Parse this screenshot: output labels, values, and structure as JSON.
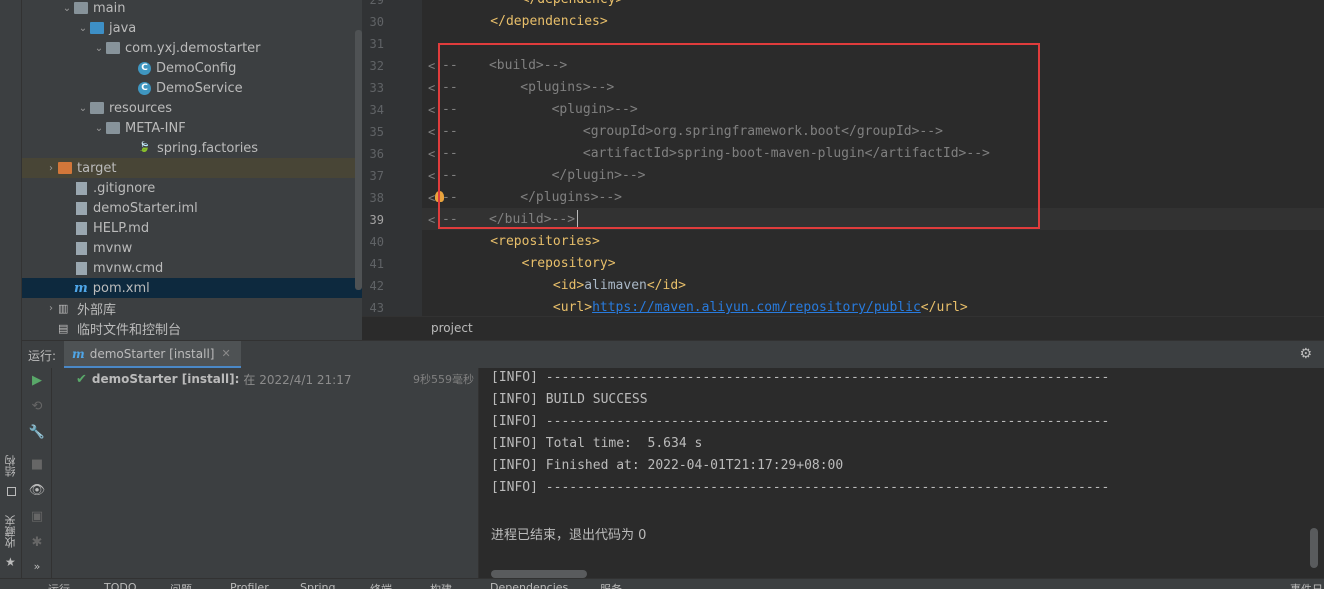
{
  "project_tree": [
    {
      "label": "main",
      "depth": 2,
      "arrow": "⌄",
      "icon": "folder-grey"
    },
    {
      "label": "java",
      "depth": 3,
      "arrow": "⌄",
      "icon": "folder-blue"
    },
    {
      "label": "com.yxj.demostarter",
      "depth": 4,
      "arrow": "⌄",
      "icon": "folder-grey"
    },
    {
      "label": "DemoConfig",
      "depth": 6,
      "arrow": "",
      "icon": "class"
    },
    {
      "label": "DemoService",
      "depth": 6,
      "arrow": "",
      "icon": "class"
    },
    {
      "label": "resources",
      "depth": 3,
      "arrow": "⌄",
      "icon": "folder-grey"
    },
    {
      "label": "META-INF",
      "depth": 4,
      "arrow": "⌄",
      "icon": "folder-grey"
    },
    {
      "label": "spring.factories",
      "depth": 6,
      "arrow": "",
      "icon": "spring-leaf"
    },
    {
      "label": "target",
      "depth": 1,
      "arrow": "›",
      "icon": "folder-orange",
      "state": "excluded"
    },
    {
      "label": ".gitignore",
      "depth": 2,
      "arrow": "",
      "icon": "file"
    },
    {
      "label": "demoStarter.iml",
      "depth": 2,
      "arrow": "",
      "icon": "file"
    },
    {
      "label": "HELP.md",
      "depth": 2,
      "arrow": "",
      "icon": "file"
    },
    {
      "label": "mvnw",
      "depth": 2,
      "arrow": "",
      "icon": "file"
    },
    {
      "label": "mvnw.cmd",
      "depth": 2,
      "arrow": "",
      "icon": "file"
    },
    {
      "label": "pom.xml",
      "depth": 2,
      "arrow": "",
      "icon": "maven",
      "state": "selected"
    },
    {
      "label": "外部库",
      "depth": 1,
      "arrow": "›",
      "icon": "library"
    },
    {
      "label": "临时文件和控制台",
      "depth": 1,
      "arrow": "",
      "icon": "scratch"
    }
  ],
  "editor": {
    "lines": [
      {
        "num": "29",
        "segments": [
          {
            "c": "tag",
            "t": "        </dependency>"
          }
        ]
      },
      {
        "num": "30",
        "segments": [
          {
            "c": "tag",
            "t": "    </dependencies>"
          }
        ]
      },
      {
        "num": "31",
        "segments": []
      },
      {
        "num": "32",
        "segments": [
          {
            "c": "cmt",
            "t": "--    <build>-->"
          }
        ]
      },
      {
        "num": "33",
        "segments": [
          {
            "c": "cmt",
            "t": "--        <plugins>-->"
          }
        ]
      },
      {
        "num": "34",
        "segments": [
          {
            "c": "cmt",
            "t": "--            <plugin>-->"
          }
        ]
      },
      {
        "num": "35",
        "segments": [
          {
            "c": "cmt",
            "t": "--                <groupId>org.springframework.boot</groupId>-->"
          }
        ]
      },
      {
        "num": "36",
        "segments": [
          {
            "c": "cmt",
            "t": "--                <artifactId>spring-boot-maven-plugin</artifactId>-->"
          }
        ]
      },
      {
        "num": "37",
        "segments": [
          {
            "c": "cmt",
            "t": "--            </plugin>-->"
          }
        ]
      },
      {
        "num": "38",
        "segments": [
          {
            "c": "cmt",
            "t": "--        </plugins>-->"
          }
        ]
      },
      {
        "num": "39",
        "segments": [
          {
            "c": "cmt",
            "t": "--    </build>-->"
          }
        ]
      },
      {
        "num": "40",
        "segments": [
          {
            "c": "tag",
            "t": "    <repositories>"
          }
        ]
      },
      {
        "num": "41",
        "segments": [
          {
            "c": "tag",
            "t": "        <repository>"
          }
        ]
      },
      {
        "num": "42",
        "segments": [
          {
            "c": "tag",
            "t": "            <id>"
          },
          {
            "c": "txt",
            "t": "alimaven"
          },
          {
            "c": "tag",
            "t": "</id>"
          }
        ]
      },
      {
        "num": "43",
        "segments": [
          {
            "c": "tag",
            "t": "            <url>"
          },
          {
            "c": "url",
            "t": "https://maven.aliyun.com/repository/public"
          },
          {
            "c": "tag",
            "t": "</url>"
          }
        ]
      }
    ],
    "breadcrumb": "project"
  },
  "run": {
    "label": "运行:",
    "tab_label": "demoStarter [install]",
    "tree_item": "demoStarter [install]:",
    "tree_item_time": "在 2022/4/1 21:17",
    "duration": "9秒559毫秒",
    "console": [
      "[INFO] ------------------------------------------------------------------------",
      "[INFO] BUILD SUCCESS",
      "[INFO] ------------------------------------------------------------------------",
      "[INFO] Total time:  5.634 s",
      "[INFO] Finished at: 2022-04-01T21:17:29+08:00",
      "[INFO] ------------------------------------------------------------------------",
      "",
      "进程已结束，退出代码为 0"
    ]
  },
  "side_tabs": {
    "structure": "结构",
    "favorites": "收藏夹"
  },
  "bottom_bar": [
    "运行",
    "TODO",
    "问题",
    "Profiler",
    "Spring",
    "终端",
    "构建",
    "Dependencies",
    "服务",
    "事件日志"
  ],
  "colors": {
    "highlight_box": "#e03c3c",
    "success_check": "#59a869",
    "comment": "#808080",
    "tag": "#e8bf6a"
  }
}
